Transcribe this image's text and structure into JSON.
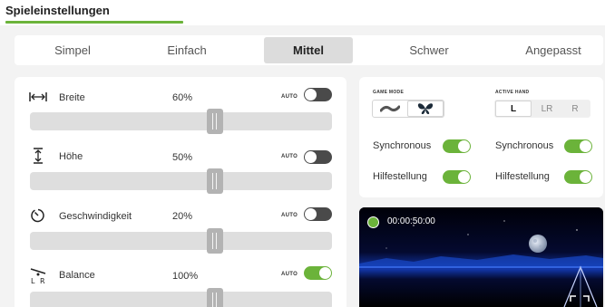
{
  "header": {
    "title": "Spieleinstellungen"
  },
  "difficulty_tabs": [
    {
      "label": "Simpel",
      "active": false
    },
    {
      "label": "Einfach",
      "active": false
    },
    {
      "label": "Mittel",
      "active": true
    },
    {
      "label": "Schwer",
      "active": false
    },
    {
      "label": "Angepasst",
      "active": false
    }
  ],
  "params": [
    {
      "label": "Breite",
      "value": "60%",
      "auto_label": "AUTO",
      "auto": false,
      "icon": "width-icon",
      "slider_level": 0.62
    },
    {
      "label": "Höhe",
      "value": "50%",
      "auto_label": "AUTO",
      "auto": false,
      "icon": "height-icon",
      "slider_level": 0.62
    },
    {
      "label": "Geschwindigkeit",
      "value": "20%",
      "auto_label": "AUTO",
      "auto": false,
      "icon": "speed-icon",
      "slider_level": 0.62
    },
    {
      "label": "Balance",
      "value": "100%",
      "auto_label": "AUTO",
      "auto": true,
      "icon": "balance-icon",
      "slider_level": 0.62
    }
  ],
  "game_mode": {
    "label": "GAME MODE",
    "options": [
      {
        "name": "wave-icon",
        "active": false
      },
      {
        "name": "butterfly-icon",
        "active": true
      }
    ]
  },
  "active_hand": {
    "label": "ACTIVE HAND",
    "options": [
      {
        "label": "L",
        "active": true
      },
      {
        "label": "LR",
        "active": false
      },
      {
        "label": "R",
        "active": false
      }
    ]
  },
  "options_left": [
    {
      "label": "Synchronous",
      "on": true
    },
    {
      "label": "Hilfestellung",
      "on": true
    }
  ],
  "options_right": [
    {
      "label": "Synchronous",
      "on": true
    },
    {
      "label": "Hilfestellung",
      "on": true
    }
  ],
  "video": {
    "timer": "00:00:50:00"
  },
  "colors": {
    "accent": "#6bb33a",
    "toggle_off": "#4a4a4a"
  }
}
